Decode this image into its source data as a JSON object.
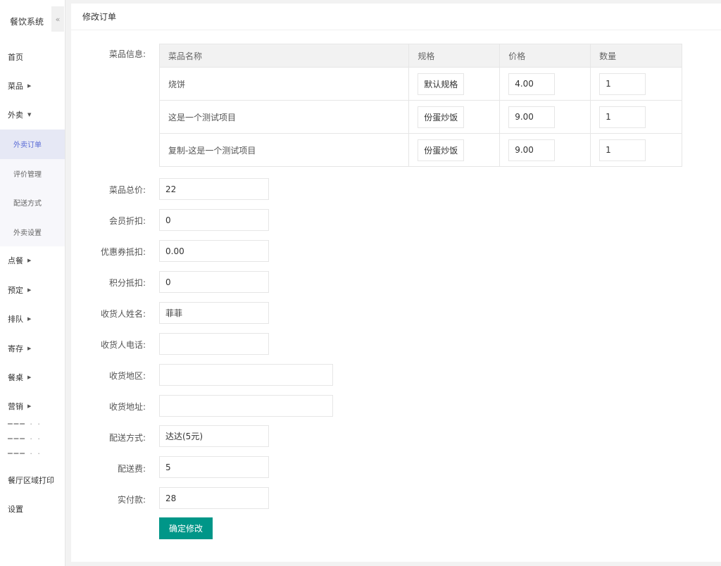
{
  "app": {
    "title": "餐饮系统",
    "collapse_glyph": "«"
  },
  "sidebar": {
    "items": [
      {
        "label": "首页"
      },
      {
        "label": "菜品",
        "arrow": "▶"
      },
      {
        "label": "外卖",
        "arrow": "▼"
      }
    ],
    "takeout_sub": [
      {
        "label": "外卖订单"
      },
      {
        "label": "评价管理"
      },
      {
        "label": "配送方式"
      },
      {
        "label": "外卖设置"
      }
    ],
    "items_after": [
      {
        "label": "点餐",
        "arrow": "▶"
      },
      {
        "label": "预定",
        "arrow": "▶"
      },
      {
        "label": "排队",
        "arrow": "▶"
      },
      {
        "label": "寄存",
        "arrow": "▶"
      },
      {
        "label": "餐桌",
        "arrow": "▶"
      },
      {
        "label": "营销",
        "arrow": "▶"
      }
    ],
    "bottom_items": [
      {
        "label": "餐厅区域打印"
      },
      {
        "label": "设置"
      }
    ]
  },
  "page": {
    "title": "修改订单"
  },
  "form": {
    "dish_info_label": "菜品信息:",
    "table": {
      "headers": [
        "菜品名称",
        "规格",
        "价格",
        "数量"
      ],
      "rows": [
        {
          "name": "烧饼",
          "spec": "默认规格",
          "price": "4.00",
          "qty": "1"
        },
        {
          "name": "这是一个测试项目",
          "spec": "份蛋炒饭",
          "price": "9.00",
          "qty": "1"
        },
        {
          "name": "复制-这是一个测试项目",
          "spec": "份蛋炒饭",
          "price": "9.00",
          "qty": "1"
        }
      ]
    },
    "fields": {
      "total_price": {
        "label": "菜品总价:",
        "value": "22"
      },
      "member_discount": {
        "label": "会员折扣:",
        "value": "0"
      },
      "coupon": {
        "label": "优惠券抵扣:",
        "value": "0.00"
      },
      "points": {
        "label": "积分抵扣:",
        "value": "0"
      },
      "receiver_name": {
        "label": "收货人姓名:",
        "value": "菲菲"
      },
      "receiver_phone": {
        "label": "收货人电话:",
        "value": ""
      },
      "region": {
        "label": "收货地区:",
        "value": ""
      },
      "address": {
        "label": "收货地址:",
        "value": ""
      },
      "delivery_method": {
        "label": "配送方式:",
        "value": "达达(5元)"
      },
      "delivery_fee": {
        "label": "配送费:",
        "value": "5"
      },
      "paid": {
        "label": "实付款:",
        "value": "28"
      }
    },
    "submit_label": "确定修改"
  },
  "colors": {
    "primary": "#009688",
    "active_menu_text": "#5a6bd6"
  }
}
